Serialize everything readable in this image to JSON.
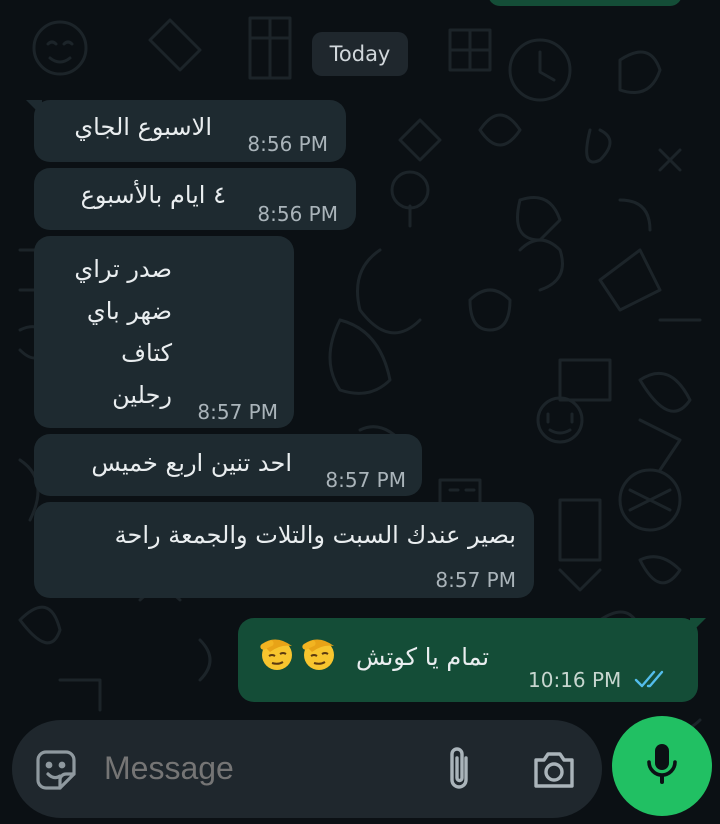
{
  "chat": {
    "date_chip": "Today",
    "messages": [
      {
        "direction": "in",
        "text": "الاسبوع الجاي",
        "time": "8:56 PM"
      },
      {
        "direction": "in",
        "text": "٤ ايام بالأسبوع",
        "time": "8:56 PM"
      },
      {
        "direction": "in",
        "lines": [
          "صدر تراي",
          "ضهر باي",
          "كتاف",
          "رجلين"
        ],
        "time": "8:57 PM"
      },
      {
        "direction": "in",
        "text": "احد تنين اربع خميس",
        "time": "8:57 PM"
      },
      {
        "direction": "in",
        "text": "بصير عندك السبت والتلات والجمعة راحة",
        "time": "8:57 PM"
      },
      {
        "direction": "out",
        "text": "تمام يا كوتش",
        "emoji": "salute-face",
        "emoji_count": 2,
        "time": "10:16 PM",
        "status": "read"
      }
    ]
  },
  "composer": {
    "placeholder": "Message",
    "icons": [
      "sticker-icon",
      "paperclip-icon",
      "camera-icon",
      "microphone-icon"
    ]
  },
  "colors": {
    "background": "#0b1014",
    "incoming_bubble": "#1e2a30",
    "outgoing_bubble": "#144d37",
    "mic_button": "#21c063",
    "read_ticks": "#53bdeb"
  }
}
